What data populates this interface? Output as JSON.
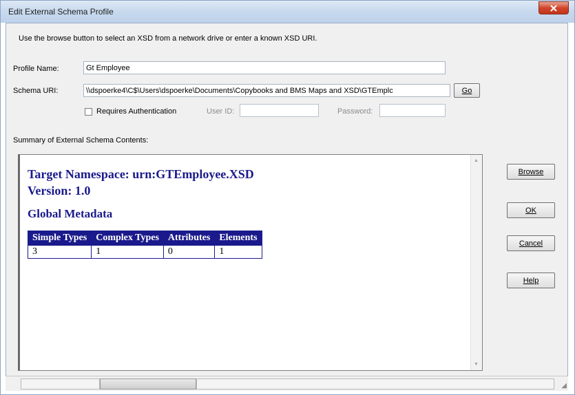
{
  "window": {
    "title": "Edit External Schema Profile"
  },
  "instruction": "Use the browse button to select an XSD from a network drive or enter a known XSD URI.",
  "profile": {
    "label": "Profile Name:",
    "value": "Gt Employee"
  },
  "schema": {
    "label": "Schema URI:",
    "value": "\\\\dspoerke4\\C$\\Users\\dspoerke\\Documents\\Copybooks and BMS Maps and XSD\\GTEmplc",
    "go_label": "Go"
  },
  "auth": {
    "requires_label": "Requires Authentication",
    "requires_checked": false,
    "userid_label": "User ID:",
    "userid_value": "",
    "password_label": "Password:",
    "password_value": ""
  },
  "summary": {
    "label": "Summary of External Schema Contents:",
    "target_namespace": "Target Namespace: urn:GTEmployee.XSD",
    "version": "Version: 1.0",
    "global_metadata": "Global Metadata",
    "table": {
      "headers": [
        "Simple Types",
        "Complex Types",
        "Attributes",
        "Elements"
      ],
      "values": [
        "3",
        "1",
        "0",
        "1"
      ]
    }
  },
  "buttons": {
    "browse": "Browse",
    "ok": "OK",
    "cancel": "Cancel",
    "help": "Help"
  },
  "icons": {
    "close": "close-icon",
    "scroll_up": "scroll-up-arrow-icon",
    "scroll_down": "scroll-down-arrow-icon",
    "resize": "resize-grip-icon"
  },
  "colors": {
    "heading": "#1a1a8c",
    "table_header_bg": "#1a1a8c",
    "close_button": "#c94a33"
  }
}
